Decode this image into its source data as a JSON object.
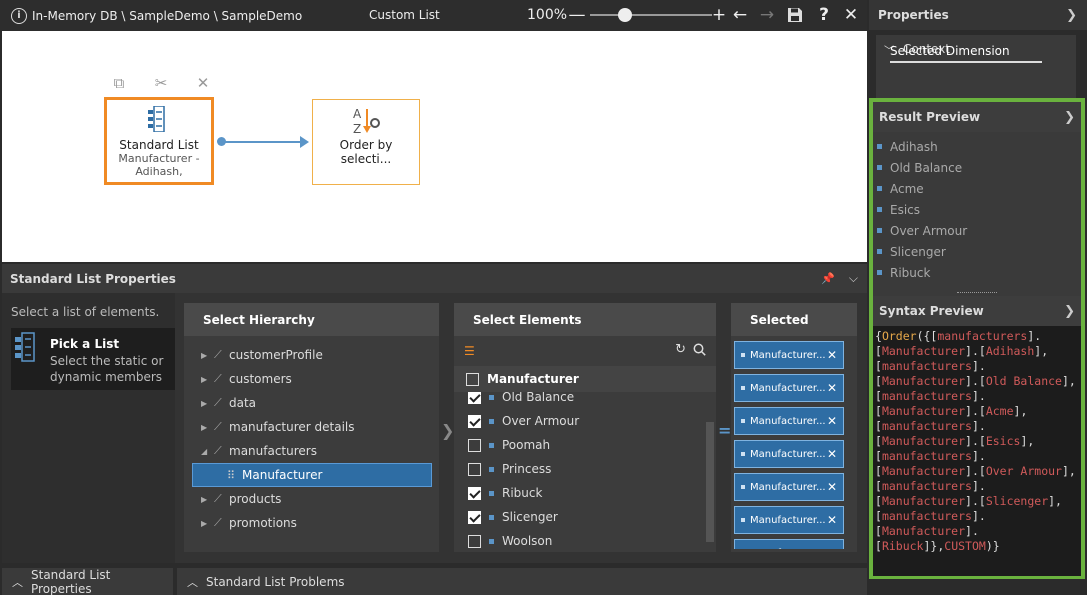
{
  "topbar": {
    "breadcrumb": "In-Memory DB \\ SampleDemo \\ SampleDemo",
    "title": "Custom List",
    "zoom": "100%",
    "zoom_level_percent": 30
  },
  "canvas": {
    "node_standard": {
      "title": "Standard List",
      "subtitle": "Manufacturer - Adihash,"
    },
    "node_order": {
      "title": "Order by selecti..."
    }
  },
  "props": {
    "header": "Standard List Properties",
    "hint": "Select a list of elements.",
    "pick": {
      "title": "Pick a List",
      "desc": "Select the static or dynamic members"
    },
    "hierarchy": {
      "title": "Select Hierarchy",
      "items": [
        {
          "label": "customerProfile",
          "expanded": false
        },
        {
          "label": "customers",
          "expanded": false
        },
        {
          "label": "data",
          "expanded": false
        },
        {
          "label": "manufacturer details",
          "expanded": false
        },
        {
          "label": "manufacturers",
          "expanded": true
        },
        {
          "label": "Manufacturer",
          "selected": true
        },
        {
          "label": "products",
          "expanded": false
        },
        {
          "label": "promotions",
          "expanded": false
        }
      ]
    },
    "elements": {
      "title": "Select Elements",
      "dimension": "Manufacturer",
      "items": [
        {
          "label": "Old Balance",
          "checked": true
        },
        {
          "label": "Over Armour",
          "checked": true
        },
        {
          "label": "Poomah",
          "checked": false
        },
        {
          "label": "Princess",
          "checked": false
        },
        {
          "label": "Ribuck",
          "checked": true
        },
        {
          "label": "Slicenger",
          "checked": true
        },
        {
          "label": "Woolson",
          "checked": false
        }
      ]
    },
    "selected": {
      "title": "Selected",
      "chips": [
        "Manufacturer...",
        "Manufacturer...",
        "Manufacturer...",
        "Manufacturer...",
        "Manufacturer...",
        "Manufacturer...",
        "Manufacturer..."
      ]
    }
  },
  "bottom_tabs": {
    "tab1": "Standard List Properties",
    "tab2": "Standard List Problems"
  },
  "right": {
    "properties": "Properties",
    "context": "Context",
    "selected_dimension": "Selected Dimension",
    "result_preview": {
      "title": "Result Preview",
      "items": [
        "Adihash",
        "Old Balance",
        "Acme",
        "Esics",
        "Over Armour",
        "Slicenger",
        "Ribuck"
      ]
    },
    "syntax_preview": {
      "title": "Syntax Preview",
      "tokens": [
        {
          "t": "{",
          "c": "p"
        },
        {
          "t": "Order",
          "c": "fn"
        },
        {
          "t": "({[",
          "c": "p"
        },
        {
          "t": "manufacturers",
          "c": "id"
        },
        {
          "t": "].\n[",
          "c": "p"
        },
        {
          "t": "Manufacturer",
          "c": "id"
        },
        {
          "t": "].[",
          "c": "p"
        },
        {
          "t": "Adihash",
          "c": "id"
        },
        {
          "t": "],\n[",
          "c": "p"
        },
        {
          "t": "manufacturers",
          "c": "id"
        },
        {
          "t": "].\n[",
          "c": "p"
        },
        {
          "t": "Manufacturer",
          "c": "id"
        },
        {
          "t": "].[",
          "c": "p"
        },
        {
          "t": "Old Balance",
          "c": "id"
        },
        {
          "t": "],\n[",
          "c": "p"
        },
        {
          "t": "manufacturers",
          "c": "id"
        },
        {
          "t": "].\n[",
          "c": "p"
        },
        {
          "t": "Manufacturer",
          "c": "id"
        },
        {
          "t": "].[",
          "c": "p"
        },
        {
          "t": "Acme",
          "c": "id"
        },
        {
          "t": "],\n[",
          "c": "p"
        },
        {
          "t": "manufacturers",
          "c": "id"
        },
        {
          "t": "].\n[",
          "c": "p"
        },
        {
          "t": "Manufacturer",
          "c": "id"
        },
        {
          "t": "].[",
          "c": "p"
        },
        {
          "t": "Esics",
          "c": "id"
        },
        {
          "t": "],\n[",
          "c": "p"
        },
        {
          "t": "manufacturers",
          "c": "id"
        },
        {
          "t": "].\n[",
          "c": "p"
        },
        {
          "t": "Manufacturer",
          "c": "id"
        },
        {
          "t": "].[",
          "c": "p"
        },
        {
          "t": "Over Armour",
          "c": "id"
        },
        {
          "t": "],\n[",
          "c": "p"
        },
        {
          "t": "manufacturers",
          "c": "id"
        },
        {
          "t": "].\n[",
          "c": "p"
        },
        {
          "t": "Manufacturer",
          "c": "id"
        },
        {
          "t": "].[",
          "c": "p"
        },
        {
          "t": "Slicenger",
          "c": "id"
        },
        {
          "t": "],\n[",
          "c": "p"
        },
        {
          "t": "manufacturers",
          "c": "id"
        },
        {
          "t": "].\n[",
          "c": "p"
        },
        {
          "t": "Manufacturer",
          "c": "id"
        },
        {
          "t": "].\n[",
          "c": "p"
        },
        {
          "t": "Ribuck",
          "c": "id"
        },
        {
          "t": "]},",
          "c": "p"
        },
        {
          "t": "CUSTOM",
          "c": "id"
        },
        {
          "t": ")}",
          "c": "p"
        }
      ]
    }
  },
  "colors": {
    "accent_orange": "#f08a24",
    "accent_blue": "#2e6da4",
    "highlight_green": "#6ab23e"
  }
}
